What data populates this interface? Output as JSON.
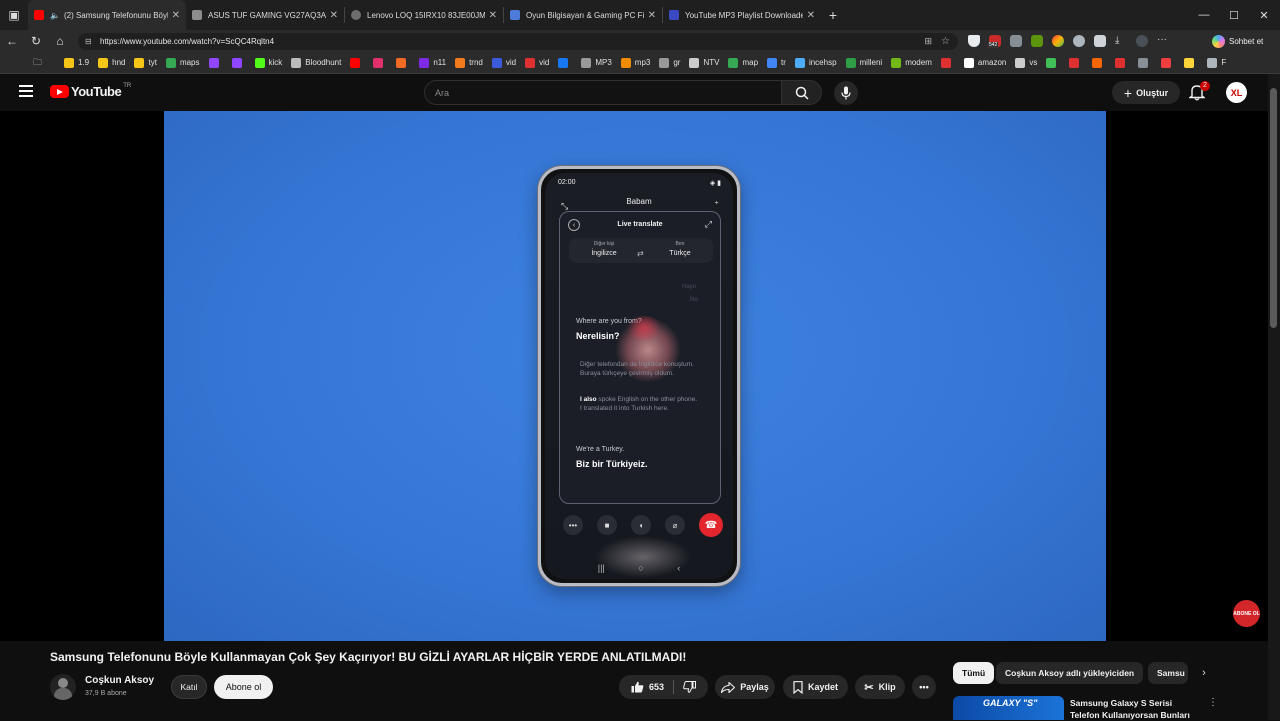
{
  "browser": {
    "tabs": [
      {
        "title": "(2) Samsung Telefonunu Böyle",
        "active": true,
        "color": "#ff0000"
      },
      {
        "title": "ASUS TUF GAMING VG27AQ3A 2",
        "active": false,
        "color": "#8d8d8d"
      },
      {
        "title": "Lenovo LOQ 15IRX10 83JE00JMT",
        "active": false,
        "color": "#6d6d6d"
      },
      {
        "title": "Oyun Bilgisayarı & Gaming PC Fi",
        "active": false,
        "color": "#4c7bd9"
      },
      {
        "title": "YouTube MP3 Playlist Downloade",
        "active": false,
        "color": "#3a48c4"
      }
    ],
    "new_tab": "+",
    "url": "https://www.youtube.com/watch?v=ScQC4Rqltn4",
    "sohbet_label": "Sohbet et",
    "ext_badge": "542",
    "bookmarks": [
      {
        "label": "1.9",
        "color": "#f5c518"
      },
      {
        "label": "hnd",
        "color": "#f5c518"
      },
      {
        "label": "tyt",
        "color": "#f5c518"
      },
      {
        "label": "maps",
        "color": "#34a853"
      },
      {
        "label": "",
        "color": "#9146ff"
      },
      {
        "label": "",
        "color": "#9146ff"
      },
      {
        "label": "kick",
        "color": "#53fc18"
      },
      {
        "label": "Bloodhunt",
        "color": "#bbbbbb"
      },
      {
        "label": "",
        "color": "#ff0000"
      },
      {
        "label": "",
        "color": "#e1306c"
      },
      {
        "label": "",
        "color": "#f06a24"
      },
      {
        "label": "n11",
        "color": "#7d2ae8"
      },
      {
        "label": "trnd",
        "color": "#f27a1a"
      },
      {
        "label": "vid",
        "color": "#3b5bdb"
      },
      {
        "label": "vid",
        "color": "#e03131"
      },
      {
        "label": "",
        "color": "#1877f2"
      },
      {
        "label": "MP3",
        "color": "#999999"
      },
      {
        "label": "mp3",
        "color": "#f08c00"
      },
      {
        "label": "gr",
        "color": "#999999"
      },
      {
        "label": "NTV",
        "color": "#cccccc"
      },
      {
        "label": "map",
        "color": "#34a853"
      },
      {
        "label": "tr",
        "color": "#4285f4"
      },
      {
        "label": "incehsp",
        "color": "#4dabf7"
      },
      {
        "label": "milleni",
        "color": "#2f9e44"
      },
      {
        "label": "modem",
        "color": "#74b816"
      },
      {
        "label": "",
        "color": "#e03131"
      },
      {
        "label": "amazon",
        "color": "#ffffff"
      },
      {
        "label": "vs",
        "color": "#cccccc"
      },
      {
        "label": "",
        "color": "#40c057"
      },
      {
        "label": "",
        "color": "#e03131"
      },
      {
        "label": "",
        "color": "#f76707"
      },
      {
        "label": "",
        "color": "#e03131"
      },
      {
        "label": "",
        "color": "#868e96"
      },
      {
        "label": "",
        "color": "#f03e3e"
      },
      {
        "label": "",
        "color": "#ffd43b"
      },
      {
        "label": "F",
        "color": "#adb5bd"
      }
    ]
  },
  "youtube": {
    "logo_text": "YouTube",
    "country": "TR",
    "search_placeholder": "Ara",
    "create_label": "Oluştur",
    "notification_count": "2",
    "avatar_initials": "XL"
  },
  "video_frame": {
    "phone_time": "02:00",
    "caller": "Babam",
    "panel_title": "Live translate",
    "other_person_label": "Diğer kişi",
    "other_person_lang": "İngilizce",
    "me_label": "Ben",
    "me_lang": "Türkçe",
    "faint_1": "Hayır",
    "faint_2": "No",
    "msg1_en": "Where are you from?",
    "msg1_tr": "Nerelisin?",
    "note_tr": "Diğer telefondan da İngilizce konuştum. Buraya türkçeye çevirmiş oldum.",
    "note_en_bold": "I also",
    "note_en_rest": " spoke English on the other phone. I translated it into Turkish here.",
    "msg2_en": "We're a Turkey.",
    "msg2_tr": "Biz bir Türkiyeiz.",
    "badge_text": "ABONE OL"
  },
  "video_info": {
    "title": "Samsung Telefonunu Böyle Kullanmayan Çok Şey Kaçırıyor! BU GİZLİ AYARLAR HİÇBİR YERDE ANLATILMADI!",
    "channel_name": "Coşkun Aksoy",
    "subscribers": "37,9 B abone",
    "join_label": "Katıl",
    "subscribe_label": "Abone ol",
    "likes": "653",
    "share_label": "Paylaş",
    "save_label": "Kaydet",
    "clip_label": "Klip"
  },
  "recommendations": {
    "chips": [
      "Tümü",
      "Coşkun Aksoy adlı yükleyiciden",
      "Samsu"
    ],
    "first_title": "Samsung Galaxy S Serisi Telefon Kullanıyorsan Bunları",
    "thumb_text": "GALAXY \"S\""
  }
}
